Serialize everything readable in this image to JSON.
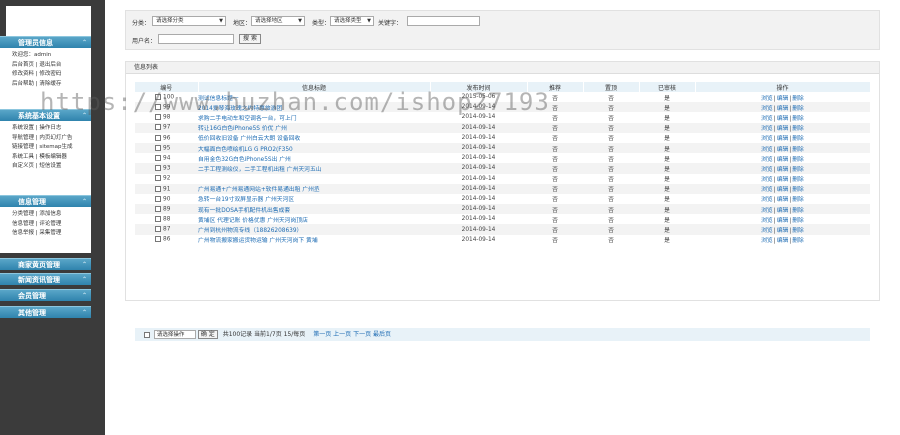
{
  "sidebar": {
    "sections": [
      {
        "title": "管理员信息",
        "items": [
          "欢迎您：admin",
          "后台首页 | 退出后台",
          "修改资料 | 修改密码",
          "后台帮助 | 清除缓存"
        ]
      },
      {
        "title": "系统基本设置",
        "items": [
          "系统设置 | 操作日志",
          "导航管理 | 内页幻灯广告",
          "链接管理 | sitemap生成",
          "系统工具 | 模板编辑器",
          "自定义页 | 短信设置"
        ]
      },
      {
        "title": "信息管理",
        "items": [
          "分类管理 | 添加信息",
          "信息管理 | 评论管理",
          "信息举报 | 采集管理"
        ]
      },
      {
        "title": "商家黄页管理",
        "items": []
      },
      {
        "title": "新闻资讯管理",
        "items": []
      },
      {
        "title": "会员管理",
        "items": []
      },
      {
        "title": "其他管理",
        "items": []
      }
    ]
  },
  "filter": {
    "category_label": "分类：",
    "category_value": "请选择分类",
    "area_label": "地区：",
    "area_value": "请选择地区",
    "type_label": "类型：",
    "type_value": "请选择类型",
    "keyword_label": "关键字：",
    "user_label": "用户名：",
    "search_button": "搜 索"
  },
  "panel": {
    "title": "信息列表"
  },
  "table": {
    "headers": [
      "编号",
      "信息标题",
      "发布时间",
      "推荐",
      "置顶",
      "已审核",
      "操作"
    ],
    "rows": [
      {
        "id": "100",
        "title": "测试信息标题一",
        "date": "2015-05-06",
        "rec": "否",
        "top": "否",
        "audit": "是"
      },
      {
        "id": "99",
        "title": "2014爱琴海玫瑰之约特惠旅游团",
        "date": "2014-09-14",
        "rec": "否",
        "top": "否",
        "audit": "是"
      },
      {
        "id": "98",
        "title": "求购二手电动车和空调各一台，可上门",
        "date": "2014-09-14",
        "rec": "否",
        "top": "否",
        "audit": "是"
      },
      {
        "id": "97",
        "title": "转让16G白色iPhone5S 价优 广州",
        "date": "2014-09-14",
        "rec": "否",
        "top": "否",
        "audit": "是"
      },
      {
        "id": "96",
        "title": "低价回收旧设备 广州白云大朗 设备回收",
        "date": "2014-09-14",
        "rec": "否",
        "top": "否",
        "audit": "是"
      },
      {
        "id": "95",
        "title": "大幅面白色喷绘机LG G PRO2(F350",
        "date": "2014-09-14",
        "rec": "否",
        "top": "否",
        "audit": "是"
      },
      {
        "id": "94",
        "title": "自用金色32G白色iPhone5S出 广州",
        "date": "2014-09-14",
        "rec": "否",
        "top": "否",
        "audit": "是"
      },
      {
        "id": "93",
        "title": "二手工程测绘仪，二手工程机出租 广州天河五山",
        "date": "2014-09-14",
        "rec": "否",
        "top": "否",
        "audit": "是"
      },
      {
        "id": "92",
        "title": "",
        "date": "2014-09-14",
        "rec": "否",
        "top": "否",
        "audit": "是"
      },
      {
        "id": "91",
        "title": "广州易通+广州易通网站+软件易通出租 广州丞",
        "date": "2014-09-14",
        "rec": "否",
        "top": "否",
        "audit": "是"
      },
      {
        "id": "90",
        "title": "急转一台19寸双屏显示器 广州天河区",
        "date": "2014-09-14",
        "rec": "否",
        "top": "否",
        "audit": "是"
      },
      {
        "id": "89",
        "title": "现有一批DOSA手机配件机出售成套",
        "date": "2014-09-14",
        "rec": "否",
        "top": "否",
        "audit": "是"
      },
      {
        "id": "88",
        "title": "黄埔区 代理记账 价格优惠 广州天河岗顶店",
        "date": "2014-09-14",
        "rec": "否",
        "top": "否",
        "audit": "是"
      },
      {
        "id": "87",
        "title": "广州到杭州物流专线（18826208639）",
        "date": "2014-09-14",
        "rec": "否",
        "top": "否",
        "audit": "是"
      },
      {
        "id": "86",
        "title": "广州物流搬家搬运货物运输 广州天河岗下 黄埔",
        "date": "2014-09-14",
        "rec": "否",
        "top": "否",
        "audit": "是"
      }
    ],
    "actions": [
      "浏览",
      "编辑",
      "删除"
    ]
  },
  "footer": {
    "select_value": "请选择操作",
    "ok_button": "确 定",
    "summary": "共100记录  当前1/7页  15/每页",
    "first": "第一页",
    "prev": "上一页",
    "next": "下一页",
    "last": "最后页"
  },
  "watermark": "https://www.huzhan.com/ishop27193",
  "colors": {
    "sidebar_bg": "#3b3b3b",
    "section_header": "#2f83ad",
    "link": "#1c6bb3",
    "table_header": "#e8f2f8"
  }
}
